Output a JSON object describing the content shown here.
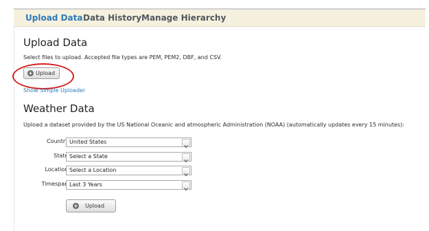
{
  "tabs": [
    {
      "label": "Upload Data"
    },
    {
      "label": "Data History"
    },
    {
      "label": "Manage Hierarchy"
    }
  ],
  "upload": {
    "title": "Upload Data",
    "description": "Select files to upload. Accepted file types are PEM, PEM2, DBF, and CSV.",
    "button_label": "Upload",
    "simple_uploader_link": "Show Simple Uploader"
  },
  "weather": {
    "title": "Weather Data",
    "description": "Upload a dataset provided by the US National Oceanic and atmospheric Administration (NOAA) (automatically updates every 15 minutes):",
    "fields": [
      {
        "label": "Country:",
        "value": "United States"
      },
      {
        "label": "State:",
        "value": "Select a State"
      },
      {
        "label": "Location:",
        "value": "Select a Location"
      },
      {
        "label": "Timespan:",
        "value": "Last 3 Years"
      }
    ],
    "button_label": "Upload"
  },
  "colors": {
    "tab_bar_bg": "#f6f1de",
    "active_tab": "#2f79b8",
    "link": "#2f79b8",
    "highlight_circle": "#d4201f"
  },
  "icons": {
    "upload_button_icon": "plus-circle-icon",
    "select_arrow_icon": "chevron-down-icon"
  }
}
